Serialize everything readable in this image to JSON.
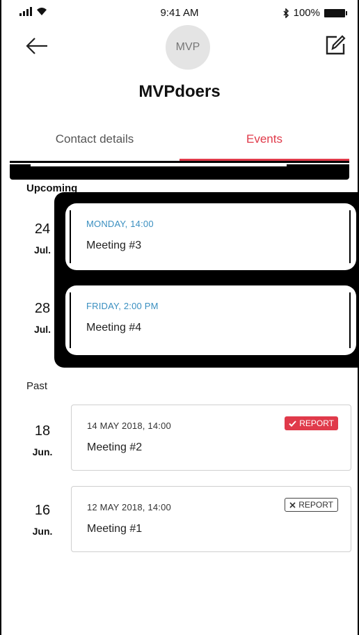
{
  "status_bar": {
    "time": "9:41 AM",
    "battery": "100%"
  },
  "header": {
    "avatar_text": "MVP",
    "title": "MVPdoers"
  },
  "tabs": [
    {
      "label": "Contact details",
      "active": false
    },
    {
      "label": "Events",
      "active": true
    }
  ],
  "sections": {
    "upcoming": "Upcoming",
    "past": "Past"
  },
  "upcoming": [
    {
      "day": "24",
      "month": "Jul.",
      "when": "MONDAY, 14:00",
      "name": "Meeting #3"
    },
    {
      "day": "28",
      "month": "Jul.",
      "when": "FRIDAY, 2:00 PM",
      "name": "Meeting #4"
    }
  ],
  "past": [
    {
      "day": "18",
      "month": "Jun.",
      "when": "14 MAY 2018, 14:00",
      "name": "Meeting #2",
      "report": {
        "label": "REPORT",
        "state": "done",
        "icon": "check-icon"
      }
    },
    {
      "day": "16",
      "month": "Jun.",
      "when": "12 MAY 2018, 14:00",
      "name": "Meeting #1",
      "report": {
        "label": "REPORT",
        "state": "todo",
        "icon": "x-icon"
      }
    }
  ],
  "colors": {
    "accent": "#e03a4a",
    "date_blue": "#3a8fc0"
  }
}
